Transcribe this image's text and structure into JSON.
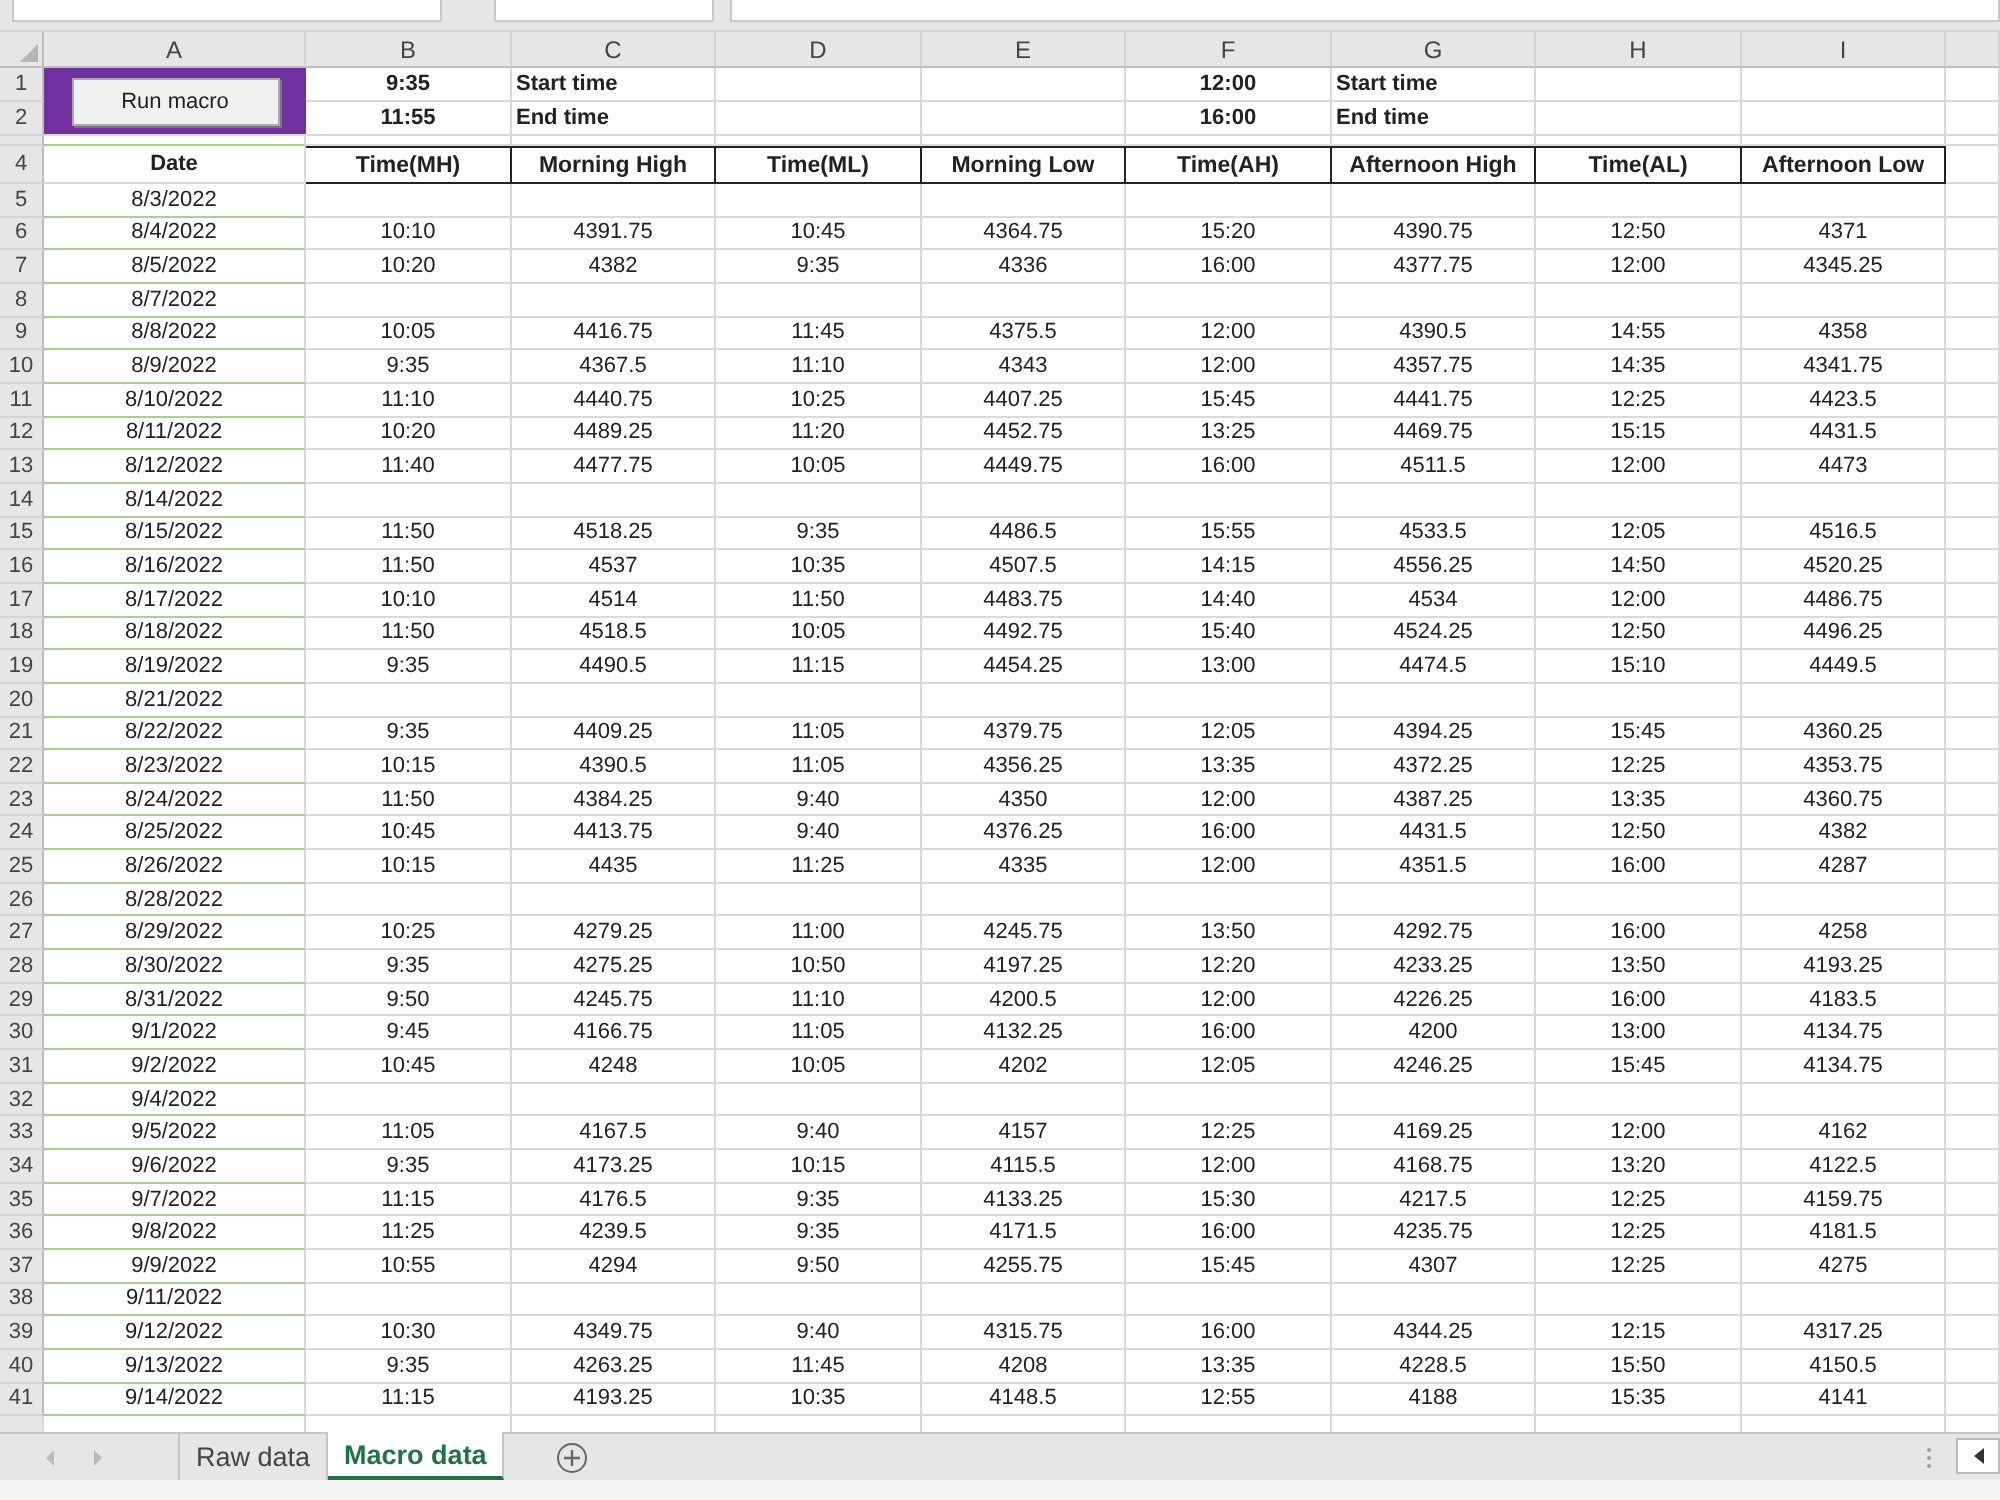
{
  "column_letters": [
    "A",
    "B",
    "C",
    "D",
    "E",
    "F",
    "G",
    "H",
    "I"
  ],
  "macro_button": {
    "label": "Run macro"
  },
  "settings_rows": [
    {
      "row": "1",
      "morning_time": "9:35",
      "morning_label": "Start time",
      "afternoon_time": "12:00",
      "afternoon_label": "Start time"
    },
    {
      "row": "2",
      "morning_time": "11:55",
      "morning_label": "End time",
      "afternoon_time": "16:00",
      "afternoon_label": "End time"
    }
  ],
  "header_row": {
    "row": "4",
    "cells": [
      "Date",
      "Time(MH)",
      "Morning High",
      "Time(ML)",
      "Morning Low",
      "Time(AH)",
      "Afternoon High",
      "Time(AL)",
      "Afternoon Low"
    ]
  },
  "rows": [
    {
      "row": "5",
      "cells": [
        "8/3/2022"
      ]
    },
    {
      "row": "6",
      "cells": [
        "8/4/2022",
        "10:10",
        "4391.75",
        "10:45",
        "4364.75",
        "15:20",
        "4390.75",
        "12:50",
        "4371"
      ]
    },
    {
      "row": "7",
      "cells": [
        "8/5/2022",
        "10:20",
        "4382",
        "9:35",
        "4336",
        "16:00",
        "4377.75",
        "12:00",
        "4345.25"
      ]
    },
    {
      "row": "8",
      "cells": [
        "8/7/2022"
      ]
    },
    {
      "row": "9",
      "cells": [
        "8/8/2022",
        "10:05",
        "4416.75",
        "11:45",
        "4375.5",
        "12:00",
        "4390.5",
        "14:55",
        "4358"
      ]
    },
    {
      "row": "10",
      "cells": [
        "8/9/2022",
        "9:35",
        "4367.5",
        "11:10",
        "4343",
        "12:00",
        "4357.75",
        "14:35",
        "4341.75"
      ]
    },
    {
      "row": "11",
      "cells": [
        "8/10/2022",
        "11:10",
        "4440.75",
        "10:25",
        "4407.25",
        "15:45",
        "4441.75",
        "12:25",
        "4423.5"
      ]
    },
    {
      "row": "12",
      "cells": [
        "8/11/2022",
        "10:20",
        "4489.25",
        "11:20",
        "4452.75",
        "13:25",
        "4469.75",
        "15:15",
        "4431.5"
      ]
    },
    {
      "row": "13",
      "cells": [
        "8/12/2022",
        "11:40",
        "4477.75",
        "10:05",
        "4449.75",
        "16:00",
        "4511.5",
        "12:00",
        "4473"
      ]
    },
    {
      "row": "14",
      "cells": [
        "8/14/2022"
      ]
    },
    {
      "row": "15",
      "cells": [
        "8/15/2022",
        "11:50",
        "4518.25",
        "9:35",
        "4486.5",
        "15:55",
        "4533.5",
        "12:05",
        "4516.5"
      ]
    },
    {
      "row": "16",
      "cells": [
        "8/16/2022",
        "11:50",
        "4537",
        "10:35",
        "4507.5",
        "14:15",
        "4556.25",
        "14:50",
        "4520.25"
      ]
    },
    {
      "row": "17",
      "cells": [
        "8/17/2022",
        "10:10",
        "4514",
        "11:50",
        "4483.75",
        "14:40",
        "4534",
        "12:00",
        "4486.75"
      ]
    },
    {
      "row": "18",
      "cells": [
        "8/18/2022",
        "11:50",
        "4518.5",
        "10:05",
        "4492.75",
        "15:40",
        "4524.25",
        "12:50",
        "4496.25"
      ]
    },
    {
      "row": "19",
      "cells": [
        "8/19/2022",
        "9:35",
        "4490.5",
        "11:15",
        "4454.25",
        "13:00",
        "4474.5",
        "15:10",
        "4449.5"
      ]
    },
    {
      "row": "20",
      "cells": [
        "8/21/2022"
      ]
    },
    {
      "row": "21",
      "cells": [
        "8/22/2022",
        "9:35",
        "4409.25",
        "11:05",
        "4379.75",
        "12:05",
        "4394.25",
        "15:45",
        "4360.25"
      ]
    },
    {
      "row": "22",
      "cells": [
        "8/23/2022",
        "10:15",
        "4390.5",
        "11:05",
        "4356.25",
        "13:35",
        "4372.25",
        "12:25",
        "4353.75"
      ]
    },
    {
      "row": "23",
      "cells": [
        "8/24/2022",
        "11:50",
        "4384.25",
        "9:40",
        "4350",
        "12:00",
        "4387.25",
        "13:35",
        "4360.75"
      ]
    },
    {
      "row": "24",
      "cells": [
        "8/25/2022",
        "10:45",
        "4413.75",
        "9:40",
        "4376.25",
        "16:00",
        "4431.5",
        "12:50",
        "4382"
      ]
    },
    {
      "row": "25",
      "cells": [
        "8/26/2022",
        "10:15",
        "4435",
        "11:25",
        "4335",
        "12:00",
        "4351.5",
        "16:00",
        "4287"
      ]
    },
    {
      "row": "26",
      "cells": [
        "8/28/2022"
      ]
    },
    {
      "row": "27",
      "cells": [
        "8/29/2022",
        "10:25",
        "4279.25",
        "11:00",
        "4245.75",
        "13:50",
        "4292.75",
        "16:00",
        "4258"
      ]
    },
    {
      "row": "28",
      "cells": [
        "8/30/2022",
        "9:35",
        "4275.25",
        "10:50",
        "4197.25",
        "12:20",
        "4233.25",
        "13:50",
        "4193.25"
      ]
    },
    {
      "row": "29",
      "cells": [
        "8/31/2022",
        "9:50",
        "4245.75",
        "11:10",
        "4200.5",
        "12:00",
        "4226.25",
        "16:00",
        "4183.5"
      ]
    },
    {
      "row": "30",
      "cells": [
        "9/1/2022",
        "9:45",
        "4166.75",
        "11:05",
        "4132.25",
        "16:00",
        "4200",
        "13:00",
        "4134.75"
      ]
    },
    {
      "row": "31",
      "cells": [
        "9/2/2022",
        "10:45",
        "4248",
        "10:05",
        "4202",
        "12:05",
        "4246.25",
        "15:45",
        "4134.75"
      ]
    },
    {
      "row": "32",
      "cells": [
        "9/4/2022"
      ]
    },
    {
      "row": "33",
      "cells": [
        "9/5/2022",
        "11:05",
        "4167.5",
        "9:40",
        "4157",
        "12:25",
        "4169.25",
        "12:00",
        "4162"
      ]
    },
    {
      "row": "34",
      "cells": [
        "9/6/2022",
        "9:35",
        "4173.25",
        "10:15",
        "4115.5",
        "12:00",
        "4168.75",
        "13:20",
        "4122.5"
      ]
    },
    {
      "row": "35",
      "cells": [
        "9/7/2022",
        "11:15",
        "4176.5",
        "9:35",
        "4133.25",
        "15:30",
        "4217.5",
        "12:25",
        "4159.75"
      ]
    },
    {
      "row": "36",
      "cells": [
        "9/8/2022",
        "11:25",
        "4239.5",
        "9:35",
        "4171.5",
        "16:00",
        "4235.75",
        "12:25",
        "4181.5"
      ]
    },
    {
      "row": "37",
      "cells": [
        "9/9/2022",
        "10:55",
        "4294",
        "9:50",
        "4255.75",
        "15:45",
        "4307",
        "12:25",
        "4275"
      ]
    },
    {
      "row": "38",
      "cells": [
        "9/11/2022"
      ]
    },
    {
      "row": "39",
      "cells": [
        "9/12/2022",
        "10:30",
        "4349.75",
        "9:40",
        "4315.75",
        "16:00",
        "4344.25",
        "12:15",
        "4317.25"
      ]
    },
    {
      "row": "40",
      "cells": [
        "9/13/2022",
        "9:35",
        "4263.25",
        "11:45",
        "4208",
        "13:35",
        "4228.5",
        "15:50",
        "4150.5"
      ]
    },
    {
      "row": "41",
      "cells": [
        "9/14/2022",
        "11:15",
        "4193.25",
        "10:35",
        "4148.5",
        "12:55",
        "4188",
        "15:35",
        "4141"
      ]
    }
  ],
  "sheet_tabs": [
    {
      "label": "Raw data",
      "selected": false
    },
    {
      "label": "Macro data",
      "selected": true
    }
  ]
}
